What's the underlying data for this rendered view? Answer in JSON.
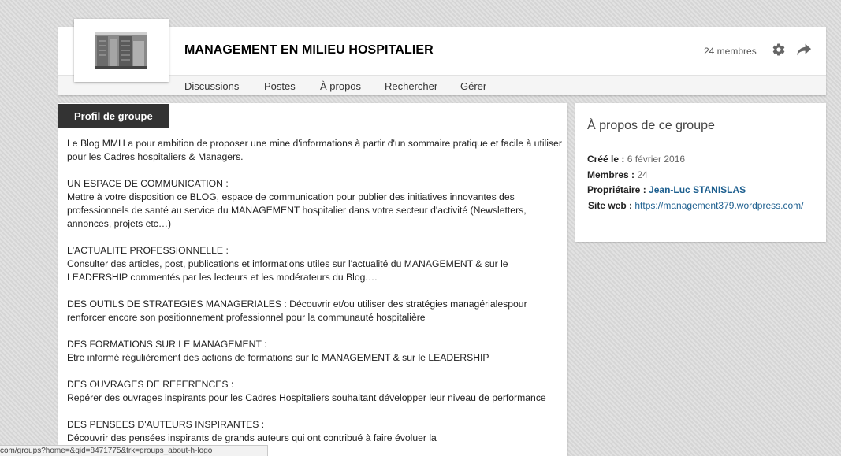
{
  "header": {
    "title": "MANAGEMENT EN MILIEU HOSPITALIER",
    "members_count": "24 membres",
    "nav": [
      "Discussions",
      "Postes",
      "À propos",
      "Rechercher",
      "Gérer"
    ]
  },
  "profile": {
    "tab_label": "Profil de groupe",
    "description": "Le Blog MMH a pour ambition de proposer une mine d'informations à partir d'un sommaire pratique et facile à utiliser pour les Cadres hospitaliers & Managers.\n\nUN ESPACE DE COMMUNICATION :\nMettre à votre disposition ce BLOG, espace de communication pour publier des initiatives innovantes des professionnels de santé au service du MANAGEMENT hospitalier dans votre secteur d'activité (Newsletters, annonces, projets etc…)\n\nL'ACTUALITE PROFESSIONNELLE :\nConsulter des articles, post, publications et informations utiles sur l'actualité du MANAGEMENT & sur le LEADERSHIP commentés par les lecteurs et les modérateurs du Blog.…\n\nDES OUTILS DE STRATEGIES MANAGERIALES : Découvrir et/ou utiliser des stratégies managérialespour renforcer encore son positionnement professionnel pour la communauté hospitalière\n\nDES FORMATIONS SUR LE MANAGEMENT :\nEtre informé régulièrement des actions de formations sur le MANAGEMENT & sur le LEADERSHIP\n\nDES OUVRAGES DE REFERENCES :\nRepérer des ouvrages inspirants pour les Cadres Hospitaliers souhaitant développer leur niveau de performance\n\nDES PENSEES D'AUTEURS INSPIRANTES :\nDécouvrir des pensées inspirants de grands auteurs qui ont contribué à faire évoluer la"
  },
  "about": {
    "title": "À propos de ce groupe",
    "created_label": "Créé le :",
    "created_value": "6 février 2016",
    "members_label": "Membres :",
    "members_value": "24",
    "owner_label": "Propriétaire :",
    "owner_value": "Jean-Luc STANISLAS",
    "site_label": "Site web :",
    "site_value": "https://management379.wordpress.com/"
  },
  "status_bar": {
    "url": "com/groups?home=&gid=8471775&trk=groups_about-h-logo"
  },
  "colors": {
    "tab_bg": "#333333",
    "link": "#1d5f8f",
    "page_bg": "#dcdcdc"
  },
  "icons": [
    "settings-icon",
    "share-icon"
  ]
}
